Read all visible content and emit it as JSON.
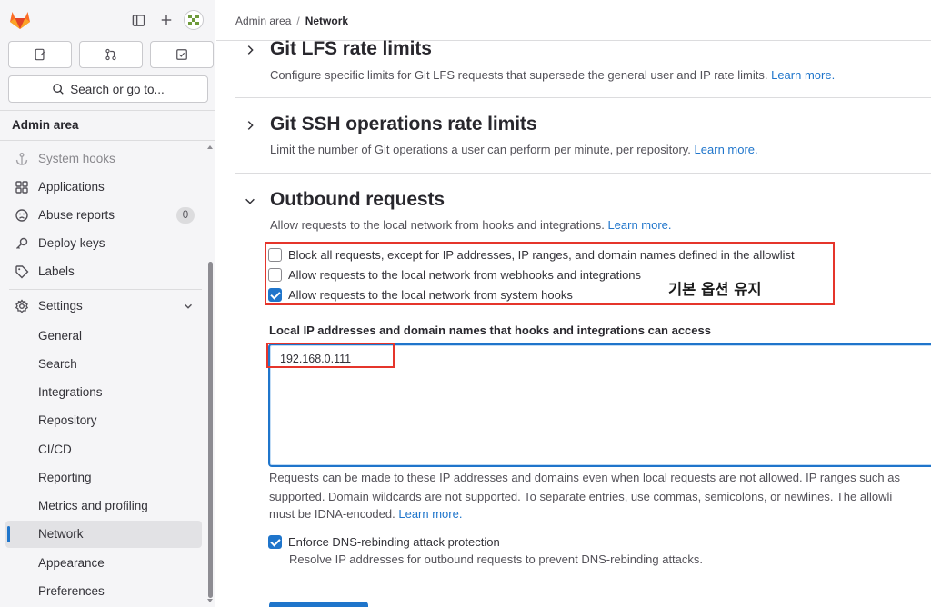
{
  "sidebar": {
    "search_label": "Search or go to...",
    "section_title": "Admin area",
    "items": [
      {
        "label": "System hooks"
      },
      {
        "label": "Applications"
      },
      {
        "label": "Abuse reports",
        "badge": "0"
      },
      {
        "label": "Deploy keys"
      },
      {
        "label": "Labels"
      },
      {
        "label": "Settings"
      }
    ],
    "settings_items": [
      {
        "label": "General"
      },
      {
        "label": "Search"
      },
      {
        "label": "Integrations"
      },
      {
        "label": "Repository"
      },
      {
        "label": "CI/CD"
      },
      {
        "label": "Reporting"
      },
      {
        "label": "Metrics and profiling"
      },
      {
        "label": "Network"
      },
      {
        "label": "Appearance"
      },
      {
        "label": "Preferences"
      }
    ]
  },
  "breadcrumb": {
    "root": "Admin area",
    "separator": "/",
    "current": "Network"
  },
  "sections": {
    "lfs": {
      "title": "Git LFS rate limits",
      "desc": "Configure specific limits for Git LFS requests that supersede the general user and IP rate limits.",
      "link": "Learn more."
    },
    "ssh": {
      "title": "Git SSH operations rate limits",
      "desc": "Limit the number of Git operations a user can perform per minute, per repository.",
      "link": "Learn more."
    },
    "outbound": {
      "title": "Outbound requests",
      "desc": "Allow requests to the local network from hooks and integrations.",
      "link": "Learn more.",
      "checkboxes": [
        {
          "label": "Block all requests, except for IP addresses, IP ranges, and domain names defined in the allowlist",
          "checked": false
        },
        {
          "label": "Allow requests to the local network from webhooks and integrations",
          "checked": false
        },
        {
          "label": "Allow requests to the local network from system hooks",
          "checked": true
        }
      ],
      "annotation": "기본 옵션 유지",
      "allowlist_label": "Local IP addresses and domain names that hooks and integrations can access",
      "allowlist_value": "192.168.0.111",
      "help_line1": "Requests can be made to these IP addresses and domains even when local requests are not allowed. IP ranges such as",
      "help_line2": "supported. Domain wildcards are not supported. To separate entries, use commas, semicolons, or newlines. The allowli",
      "help_line3": "must be IDNA-encoded.",
      "help_link": "Learn more.",
      "dns_label": "Enforce DNS-rebinding attack protection",
      "dns_checked": true,
      "dns_help": "Resolve IP addresses for outbound requests to prevent DNS-rebinding attacks."
    }
  },
  "colors": {
    "accent": "#1f75cb",
    "annotation_border": "#e5352b"
  }
}
